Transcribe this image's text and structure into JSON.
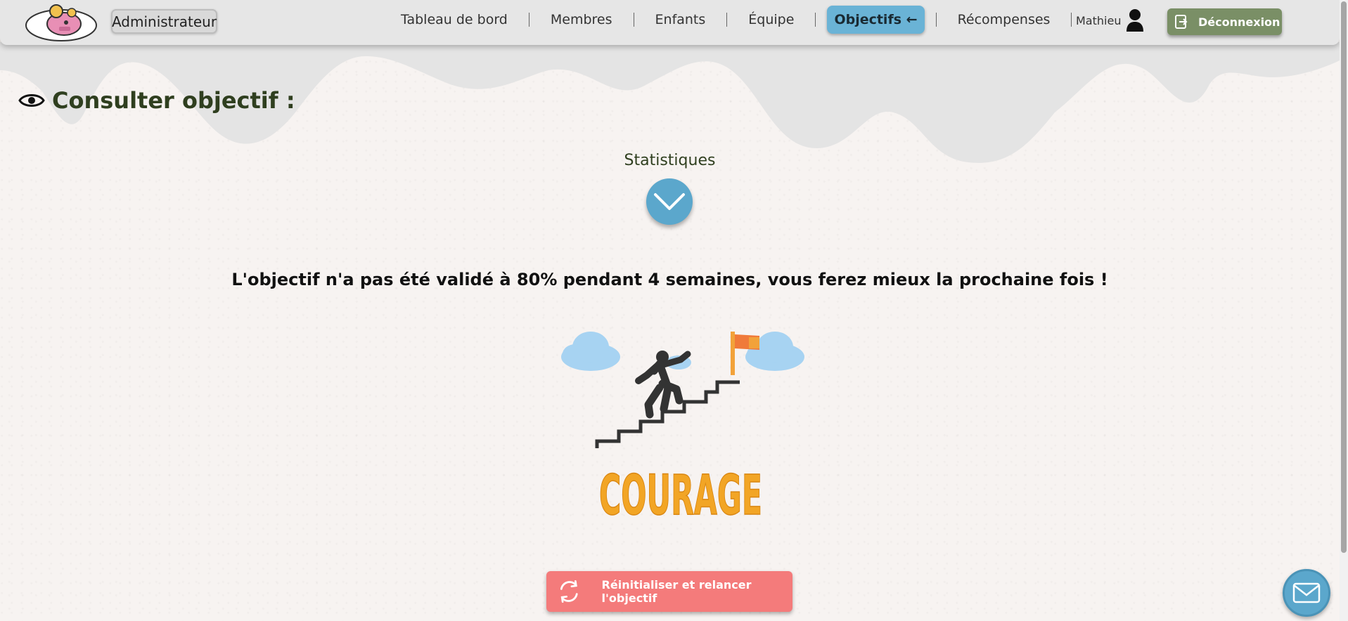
{
  "header": {
    "role_label": "Administrateur",
    "nav": [
      {
        "label": "Tableau de bord"
      },
      {
        "label": "Membres"
      },
      {
        "label": "Enfants"
      },
      {
        "label": "Équipe"
      },
      {
        "label": "Objectifs ←"
      },
      {
        "label": "Récompenses"
      }
    ],
    "active_nav": "Objectifs",
    "user_name": "Mathieu",
    "logout_label": "Déconnexion"
  },
  "main": {
    "page_title": "Consulter objectif :",
    "stats_label": "Statistiques",
    "message": "L'objectif n'a pas été validé à 80% pendant 4 semaines, vous ferez mieux la prochaine fois !",
    "illustration_text": "COURAGE",
    "reset_label": "Réinitialiser et relancer l'objectif"
  },
  "colors": {
    "accent_blue": "#5ba7cc",
    "logout_green": "#7a8f66",
    "reset_red": "#f47b7b",
    "title_green": "#2f3f1f"
  },
  "icons": [
    "logo-icon",
    "eye-icon",
    "chevron-down-icon",
    "user-icon",
    "logout-icon",
    "refresh-icon",
    "mail-icon"
  ]
}
